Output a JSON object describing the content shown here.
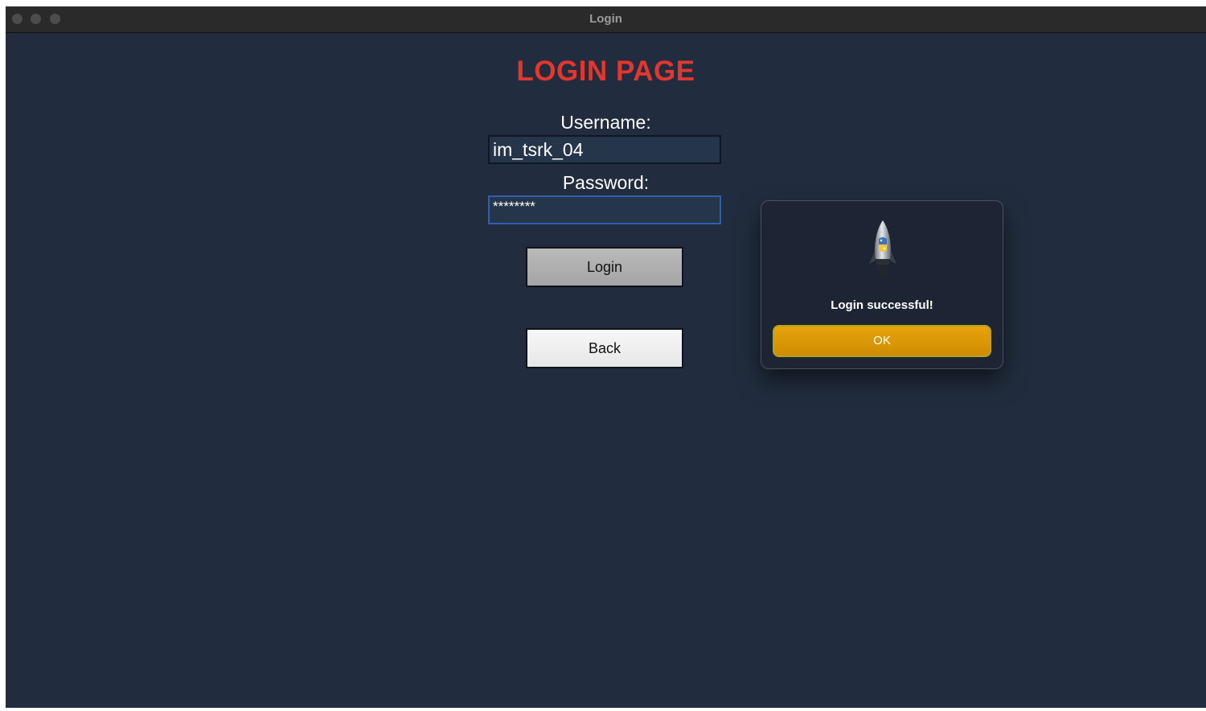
{
  "window": {
    "title": "Login"
  },
  "page": {
    "title": "LOGIN PAGE"
  },
  "form": {
    "username_label": "Username:",
    "username_value": "im_tsrk_04",
    "password_label": "Password:",
    "password_value": "********",
    "login_button": "Login",
    "back_button": "Back"
  },
  "dialog": {
    "icon": "python-rocket-icon",
    "message": "Login successful!",
    "ok_button": "OK"
  },
  "colors": {
    "background": "#212d3e",
    "title": "#e1372f",
    "ok_button": "#dc9a08",
    "password_focus_border": "#2f5fb0"
  }
}
